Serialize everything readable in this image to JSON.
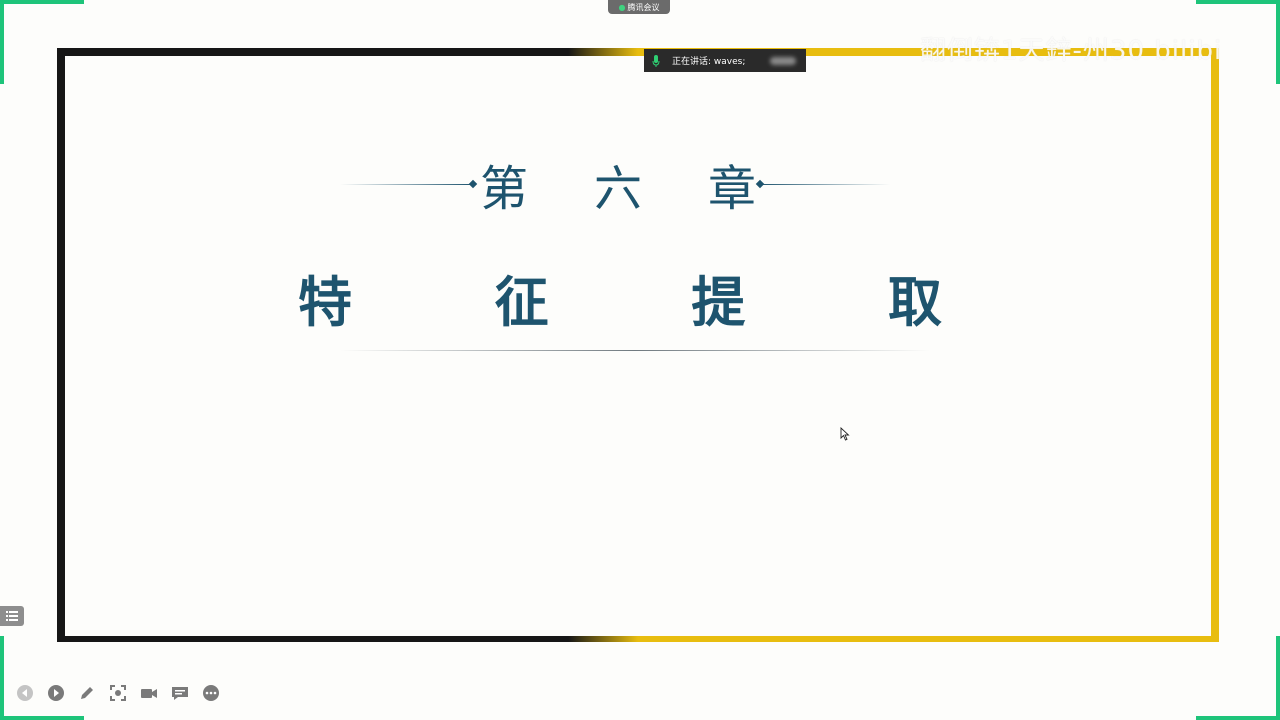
{
  "meeting": {
    "badge_label": "腾讯会议"
  },
  "speaking": {
    "text": "正在讲话: waves;"
  },
  "watermark": {
    "text": "翻倒锛1天鋅-州30  bilibili"
  },
  "slide": {
    "chapter_chars": [
      "第",
      "六",
      "章"
    ],
    "title_chars": [
      "特",
      "征",
      "提",
      "取"
    ]
  },
  "colors": {
    "accent_teal": "#1e546e",
    "frame_dark": "#161616",
    "frame_yellow": "#e8bd0f",
    "share_border_green": "#1ec47a"
  },
  "toolbar": {
    "icons": [
      "previous-icon",
      "play-icon",
      "pen-icon",
      "screenshot-icon",
      "camera-icon",
      "comment-icon",
      "more-icon"
    ]
  }
}
